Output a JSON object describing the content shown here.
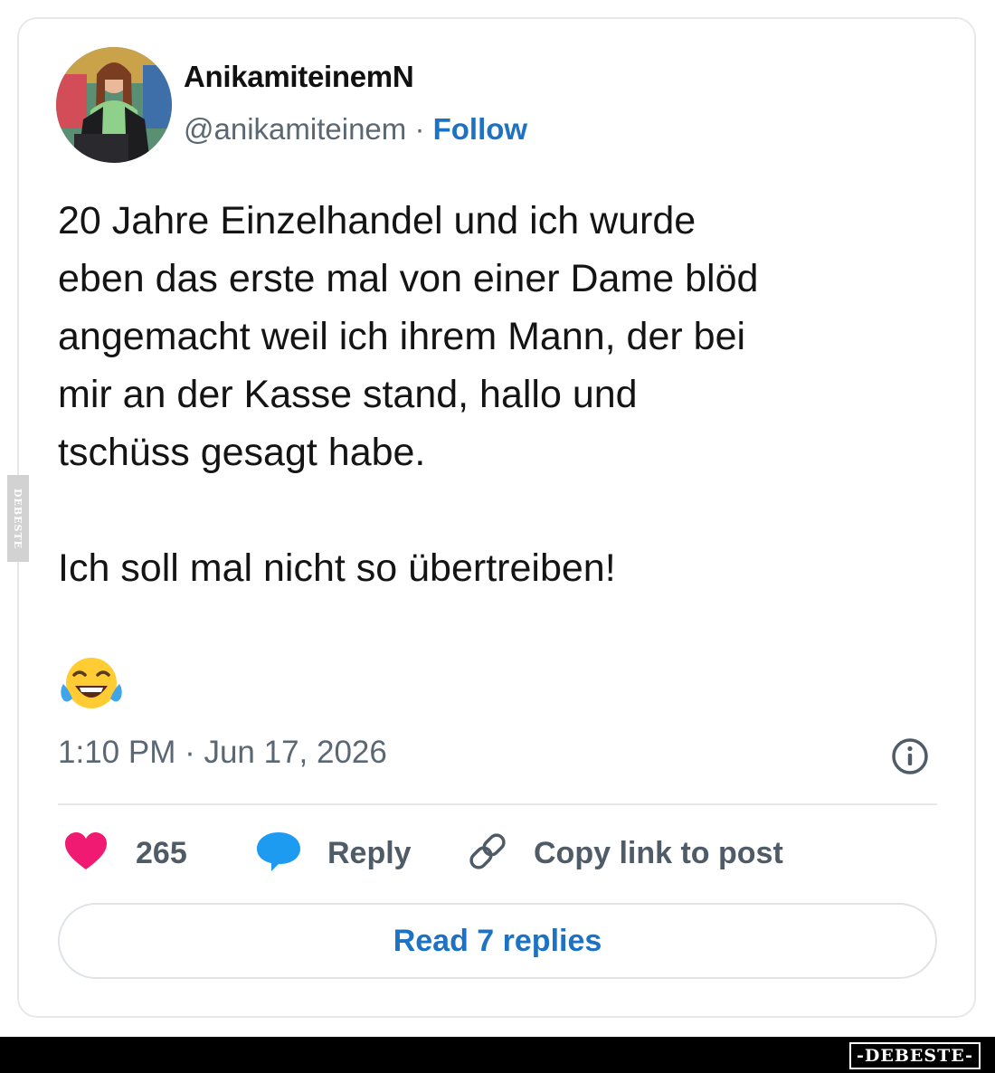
{
  "post": {
    "display_name": "AnikamiteinemN",
    "handle": "@anikamiteinem",
    "separator": "·",
    "follow_label": "Follow",
    "body": "20 Jahre Einzelhandel und ich wurde\neben das erste mal von einer Dame blöd\nangemacht weil ich ihrem Mann, der bei\nmir an der Kasse stand, hallo und\ntschüss gesagt habe.\n\nIch soll mal nicht so übertreiben!",
    "emoji": "face-with-tears-of-joy",
    "timestamp": "1:10 PM · Jun 17, 2026"
  },
  "actions": {
    "like_count": "265",
    "reply_label": "Reply",
    "copy_link_label": "Copy link to post"
  },
  "read_replies_label": "Read 7 replies",
  "watermark": {
    "side_text": "DEBESTE",
    "brand_text": "-DEBESTE-"
  },
  "icons": {
    "info": "info-icon",
    "like": "heart-icon",
    "reply": "speech-bubble-icon",
    "copy": "link-icon"
  },
  "colors": {
    "accent": "#1d72c4",
    "like": "#f01a72",
    "reply": "#1d9bf0",
    "muted": "#5b6772"
  }
}
